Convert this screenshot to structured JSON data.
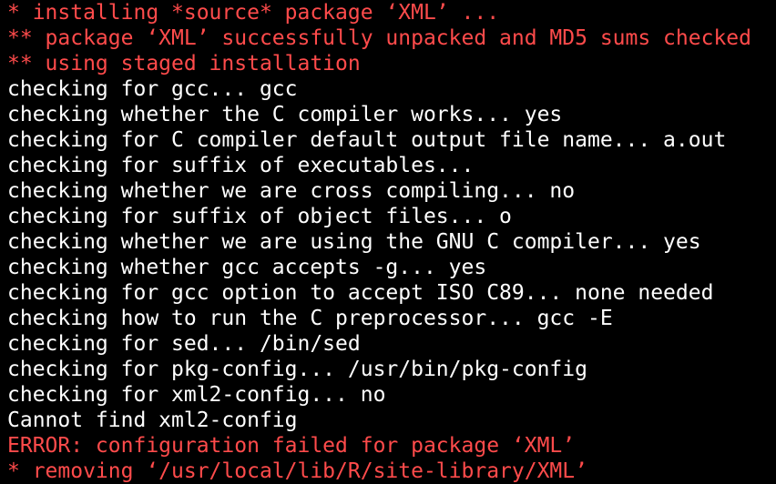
{
  "terminal": {
    "colors": {
      "background": "#000000",
      "text": "#ffffff",
      "error": "#ff4b4b"
    },
    "lines": [
      {
        "text": "* installing *source* package ‘XML’ ...",
        "style": "error"
      },
      {
        "text": "** package ‘XML’ successfully unpacked and MD5 sums checked",
        "style": "error"
      },
      {
        "text": "** using staged installation",
        "style": "error"
      },
      {
        "text": "checking for gcc... gcc",
        "style": "normal"
      },
      {
        "text": "checking whether the C compiler works... yes",
        "style": "normal"
      },
      {
        "text": "checking for C compiler default output file name... a.out",
        "style": "normal"
      },
      {
        "text": "checking for suffix of executables...",
        "style": "normal"
      },
      {
        "text": "checking whether we are cross compiling... no",
        "style": "normal"
      },
      {
        "text": "checking for suffix of object files... o",
        "style": "normal"
      },
      {
        "text": "checking whether we are using the GNU C compiler... yes",
        "style": "normal"
      },
      {
        "text": "checking whether gcc accepts -g... yes",
        "style": "normal"
      },
      {
        "text": "checking for gcc option to accept ISO C89... none needed",
        "style": "normal"
      },
      {
        "text": "checking how to run the C preprocessor... gcc -E",
        "style": "normal"
      },
      {
        "text": "checking for sed... /bin/sed",
        "style": "normal"
      },
      {
        "text": "checking for pkg-config... /usr/bin/pkg-config",
        "style": "normal"
      },
      {
        "text": "checking for xml2-config... no",
        "style": "normal"
      },
      {
        "text": "Cannot find xml2-config",
        "style": "normal"
      },
      {
        "text": "ERROR: configuration failed for package ‘XML’",
        "style": "error"
      },
      {
        "text": "* removing ‘/usr/local/lib/R/site-library/XML’",
        "style": "error"
      }
    ]
  }
}
